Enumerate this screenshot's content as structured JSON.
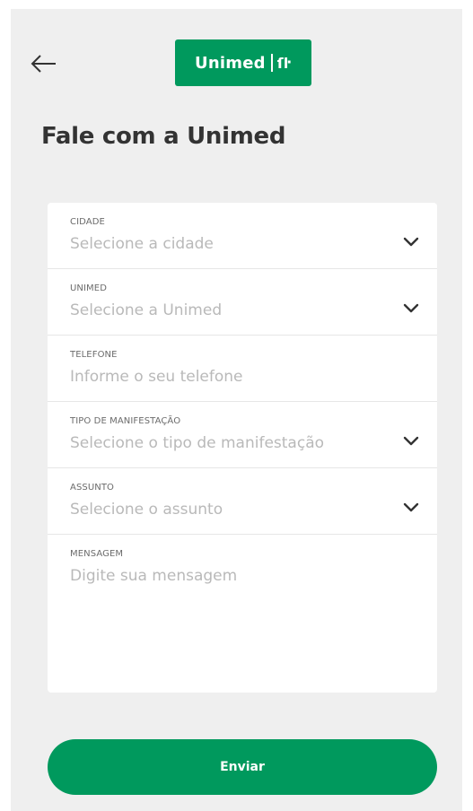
{
  "header": {
    "back_icon": "arrow-left-icon",
    "logo_text": "Unimed",
    "logo_mark": "ſŀ"
  },
  "page": {
    "title": "Fale com a Unimed"
  },
  "form": {
    "fields": [
      {
        "label": "CIDADE",
        "placeholder": "Selecione a cidade",
        "icon": "chevron-down-icon"
      },
      {
        "label": "UNIMED",
        "placeholder": "Selecione a Unimed",
        "icon": "chevron-down-icon"
      },
      {
        "label": "TELEFONE",
        "placeholder": "Informe o seu telefone"
      },
      {
        "label": "TIPO DE MANIFESTAÇÃO",
        "placeholder": "Selecione o tipo de manifestação",
        "icon": "chevron-down-icon"
      },
      {
        "label": "ASSUNTO",
        "placeholder": "Selecione o assunto",
        "icon": "chevron-down-icon"
      },
      {
        "label": "MENSAGEM",
        "placeholder": "Digite sua mensagem"
      }
    ],
    "submit_label": "Enviar"
  },
  "colors": {
    "brand_green": "#00995d",
    "background": "#efefef",
    "card": "#ffffff"
  }
}
